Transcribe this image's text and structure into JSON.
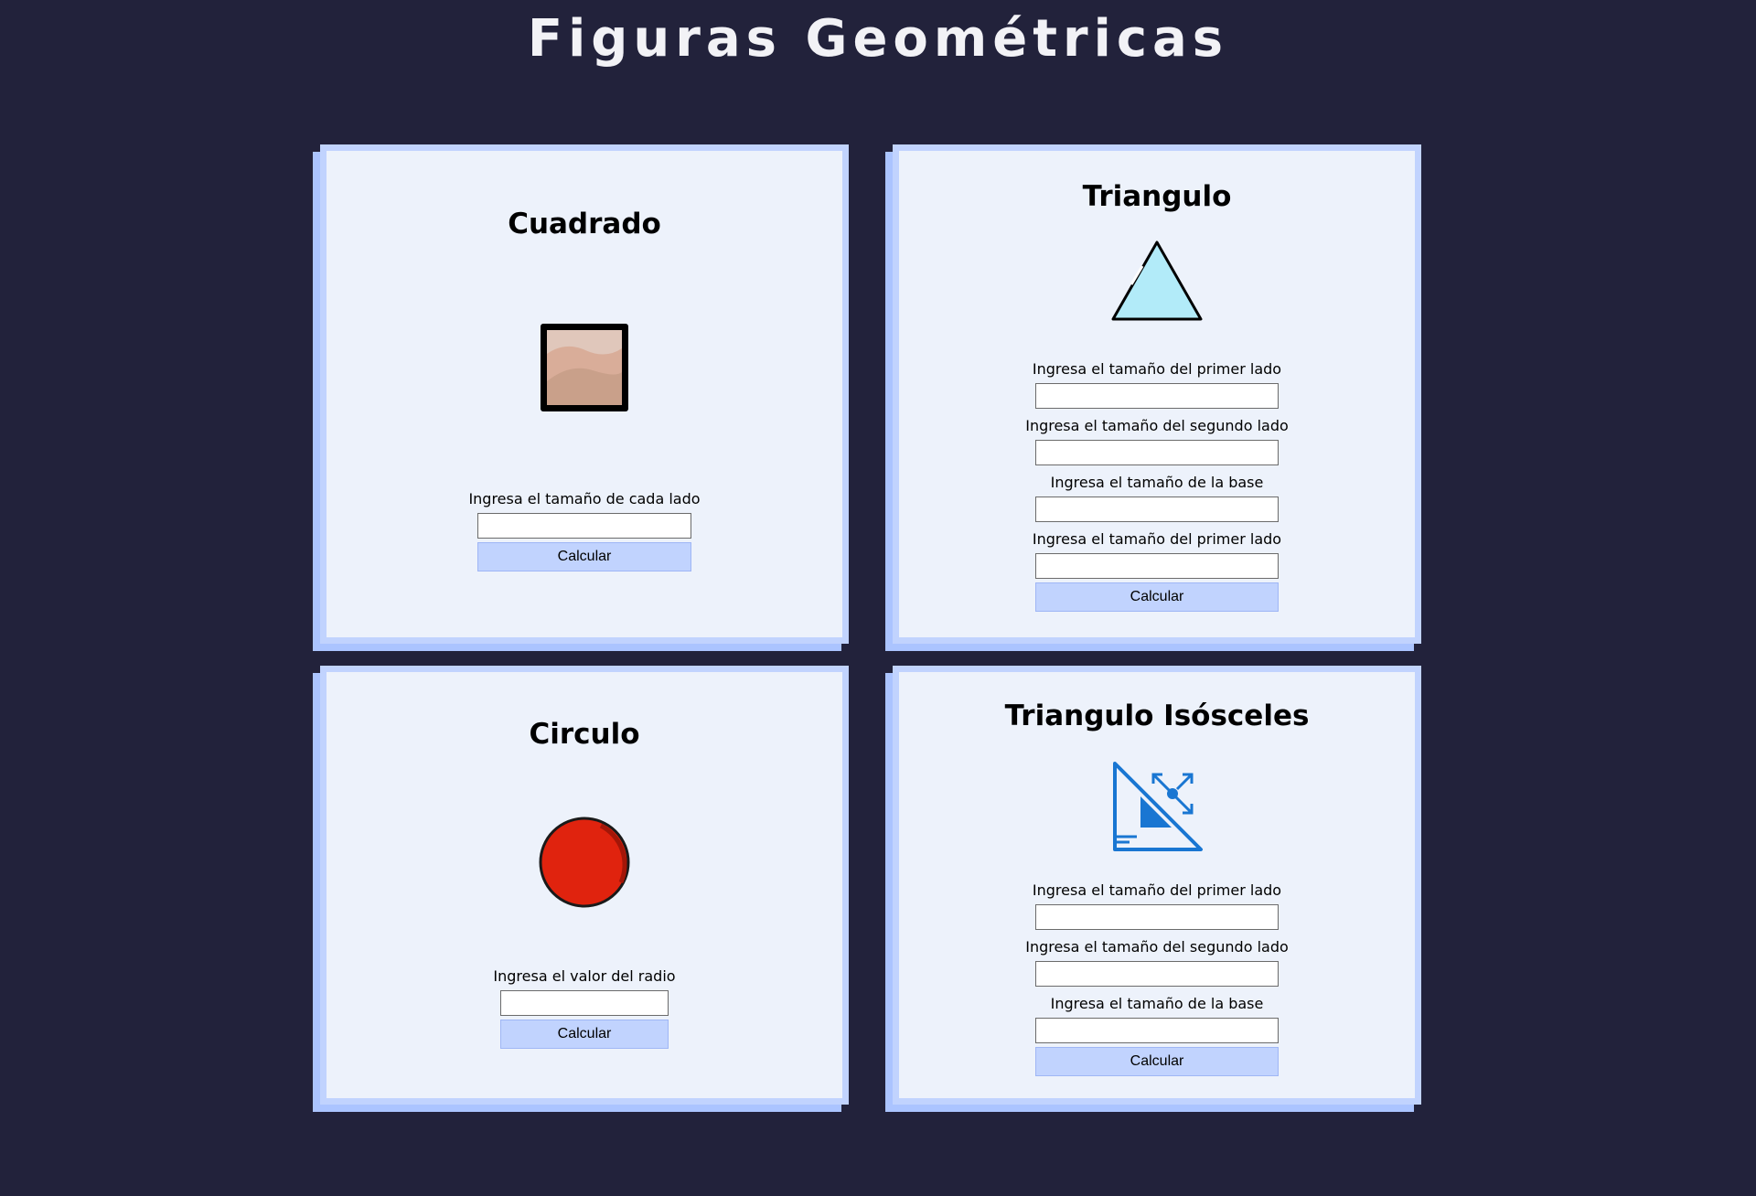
{
  "page": {
    "title": "Figuras Geométricas"
  },
  "cards": {
    "cuadrado": {
      "title": "Cuadrado",
      "icon": "framed-picture-icon",
      "fields": [
        {
          "label": "Ingresa el tamaño de cada lado",
          "value": ""
        }
      ],
      "button": "Calcular"
    },
    "triangulo": {
      "title": "Triangulo",
      "icon": "triangle-icon",
      "fields": [
        {
          "label": "Ingresa el tamaño del primer lado",
          "value": ""
        },
        {
          "label": "Ingresa el tamaño del segundo lado",
          "value": ""
        },
        {
          "label": "Ingresa el tamaño de la base",
          "value": ""
        },
        {
          "label": "Ingresa el tamaño del primer lado",
          "value": ""
        }
      ],
      "button": "Calcular"
    },
    "circulo": {
      "title": "Circulo",
      "icon": "red-circle-icon",
      "fields": [
        {
          "label": "Ingresa el valor del radio",
          "value": ""
        }
      ],
      "button": "Calcular"
    },
    "isosceles": {
      "title": "Triangulo Isósceles",
      "icon": "set-square-resize-icon",
      "fields": [
        {
          "label": "Ingresa el tamaño del primer lado",
          "value": ""
        },
        {
          "label": "Ingresa el tamaño del segundo lado",
          "value": ""
        },
        {
          "label": "Ingresa el tamaño de la base",
          "value": ""
        }
      ],
      "button": "Calcular"
    }
  },
  "colors": {
    "background": "#22223b",
    "card": "#edf2fb",
    "card_border": "#c1d3fe",
    "button": "#c1d3fe",
    "circle": "#e0230e",
    "triangle_fill": "#b2ebf9",
    "icon_blue": "#1976d2"
  }
}
